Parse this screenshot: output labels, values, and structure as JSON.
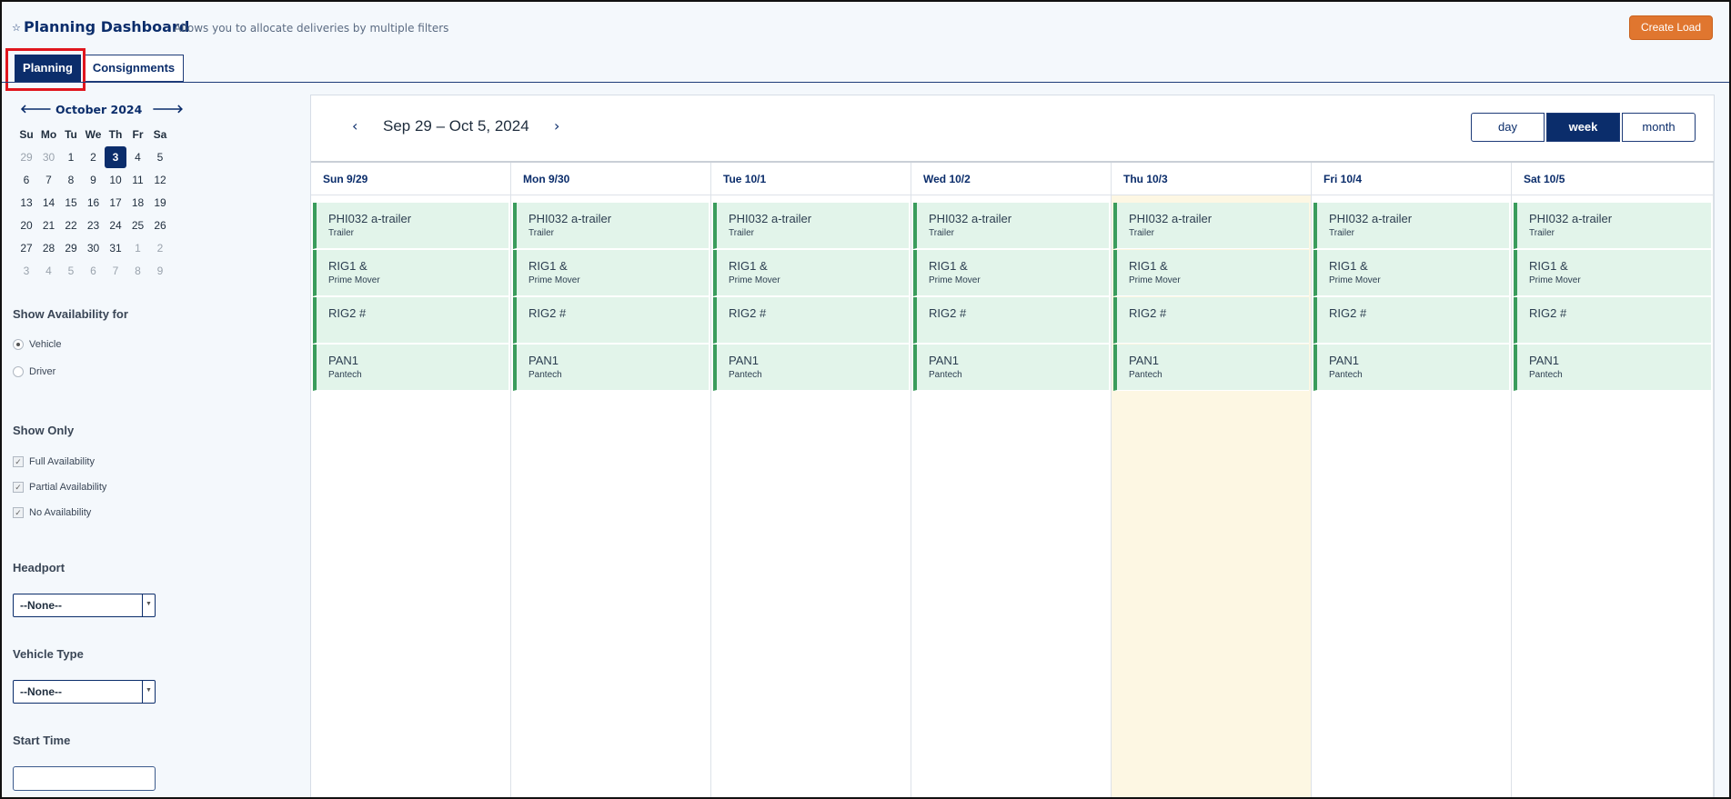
{
  "header": {
    "title": "Planning Dashboard",
    "subtitle": "Allows you to allocate deliveries by multiple filters",
    "create_load": "Create Load"
  },
  "tabs": [
    {
      "label": "Planning",
      "active": true
    },
    {
      "label": "Consignments",
      "active": false
    }
  ],
  "mini_calendar": {
    "month_label": "October 2024",
    "days_of_week": [
      "Su",
      "Mo",
      "Tu",
      "We",
      "Th",
      "Fr",
      "Sa"
    ],
    "weeks": [
      [
        "29",
        "30",
        "1",
        "2",
        "3",
        "4",
        "5"
      ],
      [
        "6",
        "7",
        "8",
        "9",
        "10",
        "11",
        "12"
      ],
      [
        "13",
        "14",
        "15",
        "16",
        "17",
        "18",
        "19"
      ],
      [
        "20",
        "21",
        "22",
        "23",
        "24",
        "25",
        "26"
      ],
      [
        "27",
        "28",
        "29",
        "30",
        "31",
        "1",
        "2"
      ],
      [
        "3",
        "4",
        "5",
        "6",
        "7",
        "8",
        "9"
      ]
    ],
    "selected_day": "3"
  },
  "sidebar": {
    "availability_label": "Show Availability for",
    "availability_options": [
      {
        "label": "Vehicle",
        "checked": true
      },
      {
        "label": "Driver",
        "checked": false
      }
    ],
    "show_only_label": "Show Only",
    "show_only_options": [
      {
        "label": "Full Availability",
        "checked": true
      },
      {
        "label": "Partial Availability",
        "checked": true
      },
      {
        "label": "No Availability",
        "checked": true
      }
    ],
    "headport_label": "Headport",
    "headport_value": "--None--",
    "vehicle_type_label": "Vehicle Type",
    "vehicle_type_value": "--None--",
    "start_time_label": "Start Time",
    "start_time_value": ""
  },
  "calendar": {
    "range_title": "Sep 29 – Oct 5, 2024",
    "views": [
      "day",
      "week",
      "month"
    ],
    "active_view": "week",
    "columns": [
      "Sun 9/29",
      "Mon 9/30",
      "Tue 10/1",
      "Wed 10/2",
      "Thu 10/3",
      "Fri 10/4",
      "Sat 10/5"
    ],
    "today_column": "Thu 10/3",
    "events": [
      {
        "title": "PHI032 a-trailer",
        "sub": "Trailer"
      },
      {
        "title": "RIG1 &",
        "sub": "Prime Mover"
      },
      {
        "title": "RIG2 #",
        "sub": ""
      },
      {
        "title": "PAN1",
        "sub": "Pantech"
      }
    ]
  },
  "colors": {
    "primary": "#0b2d6b",
    "accent": "#e0762f",
    "event_bg": "#e2f4ea",
    "event_border": "#3a9c5c",
    "today_bg": "#fdf7e3"
  }
}
